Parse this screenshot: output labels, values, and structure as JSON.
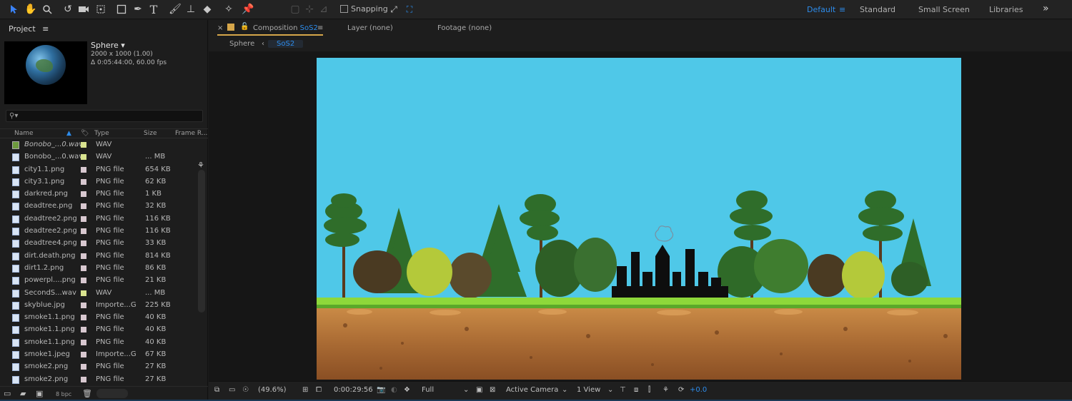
{
  "toolbar": {
    "snapping_label": "Snapping",
    "workspaces": [
      "Default",
      "Standard",
      "Small Screen",
      "Libraries"
    ],
    "overflow": "»"
  },
  "project": {
    "title": "Project",
    "menu": "≡",
    "comp_name": "Sphere ▾",
    "comp_size": "2000 x 1000 (1.00)",
    "comp_duration": "Δ 0:05:44:00, 60.00 fps",
    "search_glyph": "⚲▾",
    "columns": {
      "name": "Name",
      "type": "Type",
      "size": "Size",
      "frame": "Frame R..."
    },
    "files": [
      {
        "name": "Bonobo_...0.wav",
        "type": "WAV",
        "size": "",
        "icon": "audio",
        "italic": true,
        "label": "#d9e38f"
      },
      {
        "name": "Bonobo_...0.wav",
        "type": "WAV",
        "size": "... MB",
        "icon": "audio-file",
        "italic": false,
        "label": "#d9e38f"
      },
      {
        "name": "city1.1.png",
        "type": "PNG file",
        "size": "654 KB",
        "icon": "image",
        "italic": false,
        "label": "#d8c8d0"
      },
      {
        "name": "city3.1.png",
        "type": "PNG file",
        "size": "62 KB",
        "icon": "image",
        "italic": false,
        "label": "#d8c8d0"
      },
      {
        "name": "darkred.png",
        "type": "PNG file",
        "size": "1 KB",
        "icon": "image",
        "italic": false,
        "label": "#d8c8d0"
      },
      {
        "name": "deadtree.png",
        "type": "PNG file",
        "size": "32 KB",
        "icon": "image",
        "italic": false,
        "label": "#d8c8d0"
      },
      {
        "name": "deadtree2.png",
        "type": "PNG file",
        "size": "116 KB",
        "icon": "image",
        "italic": false,
        "label": "#d8c8d0"
      },
      {
        "name": "deadtree2.png",
        "type": "PNG file",
        "size": "116 KB",
        "icon": "image",
        "italic": false,
        "label": "#d8c8d0"
      },
      {
        "name": "deadtree4.png",
        "type": "PNG file",
        "size": "33 KB",
        "icon": "image",
        "italic": false,
        "label": "#d8c8d0"
      },
      {
        "name": "dirt.death.png",
        "type": "PNG file",
        "size": "814 KB",
        "icon": "image",
        "italic": false,
        "label": "#d8c8d0"
      },
      {
        "name": "dirt1.2.png",
        "type": "PNG file",
        "size": "86 KB",
        "icon": "image",
        "italic": false,
        "label": "#d8c8d0"
      },
      {
        "name": "powerpl....png",
        "type": "PNG file",
        "size": "21 KB",
        "icon": "image",
        "italic": false,
        "label": "#d8c8d0"
      },
      {
        "name": "SecondS...wav",
        "type": "WAV",
        "size": "... MB",
        "icon": "audio-file",
        "italic": false,
        "label": "#d9e38f"
      },
      {
        "name": "skyblue.jpg",
        "type": "Importe...G",
        "size": "225 KB",
        "icon": "image",
        "italic": false,
        "label": "#d8c8d0"
      },
      {
        "name": "smoke1.1.png",
        "type": "PNG file",
        "size": "40 KB",
        "icon": "image",
        "italic": false,
        "label": "#d8c8d0"
      },
      {
        "name": "smoke1.1.png",
        "type": "PNG file",
        "size": "40 KB",
        "icon": "image",
        "italic": false,
        "label": "#d8c8d0"
      },
      {
        "name": "smoke1.1.png",
        "type": "PNG file",
        "size": "40 KB",
        "icon": "image",
        "italic": false,
        "label": "#d8c8d0"
      },
      {
        "name": "smoke1.jpeg",
        "type": "Importe...G",
        "size": "67 KB",
        "icon": "image",
        "italic": false,
        "label": "#d8c8d0"
      },
      {
        "name": "smoke2.png",
        "type": "PNG file",
        "size": "27 KB",
        "icon": "image",
        "italic": false,
        "label": "#d8c8d0"
      },
      {
        "name": "smoke2.png",
        "type": "PNG file",
        "size": "27 KB",
        "icon": "image",
        "italic": false,
        "label": "#d8c8d0"
      }
    ],
    "bpc": "8 bpc"
  },
  "viewer": {
    "tabs": {
      "composition_prefix": "Composition",
      "composition_name": "SoS2",
      "layer": "Layer (none)",
      "footage": "Footage (none)"
    },
    "breadcrumbs": [
      "Sphere",
      "SoS2"
    ],
    "status": {
      "zoom": "(49.6%)",
      "timecode": "0:00:29:56",
      "resolution": "Full",
      "camera": "Active Camera",
      "views": "1 View",
      "exposure": "+0.0"
    }
  },
  "colors": {
    "accent": "#2d8ceb",
    "sky": "#4fc8e8",
    "tab_underline": "#d6a64a"
  }
}
